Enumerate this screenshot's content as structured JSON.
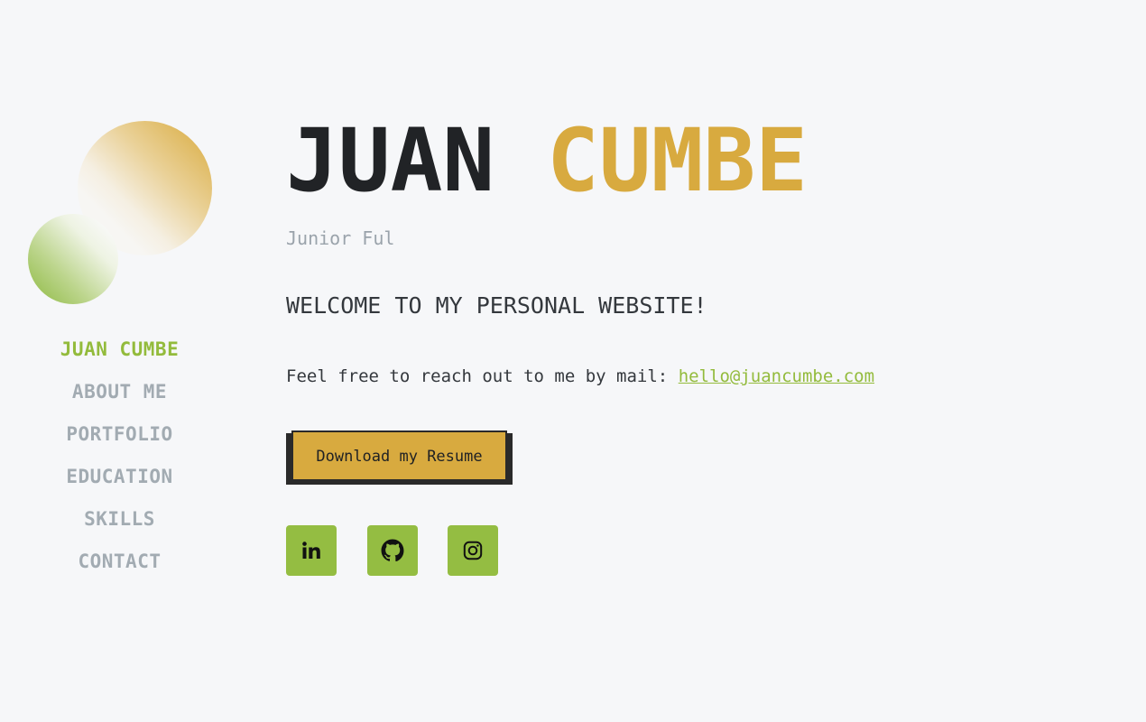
{
  "sidebar": {
    "nav": [
      {
        "label": "JUAN CUMBE",
        "active": true
      },
      {
        "label": "ABOUT ME",
        "active": false
      },
      {
        "label": "PORTFOLIO",
        "active": false
      },
      {
        "label": "EDUCATION",
        "active": false
      },
      {
        "label": "SKILLS",
        "active": false
      },
      {
        "label": "CONTACT",
        "active": false
      }
    ]
  },
  "hero": {
    "first_name": "JUAN",
    "last_name": "CUMBE",
    "subtitle": "Junior Ful",
    "welcome": "WELCOME TO MY PERSONAL WEBSITE!",
    "contact_text": "Feel free to reach out to me by mail: ",
    "email": "hello@juancumbe.com",
    "resume_label": "Download my Resume"
  },
  "socials": [
    {
      "icon": "linkedin-icon"
    },
    {
      "icon": "github-icon"
    },
    {
      "icon": "instagram-icon"
    }
  ],
  "colors": {
    "background": "#f6f7f9",
    "accent_gold": "#d8aa3f",
    "accent_green": "#93bb3c",
    "nav_inactive": "#a2abb2",
    "text_dark": "#212326"
  }
}
